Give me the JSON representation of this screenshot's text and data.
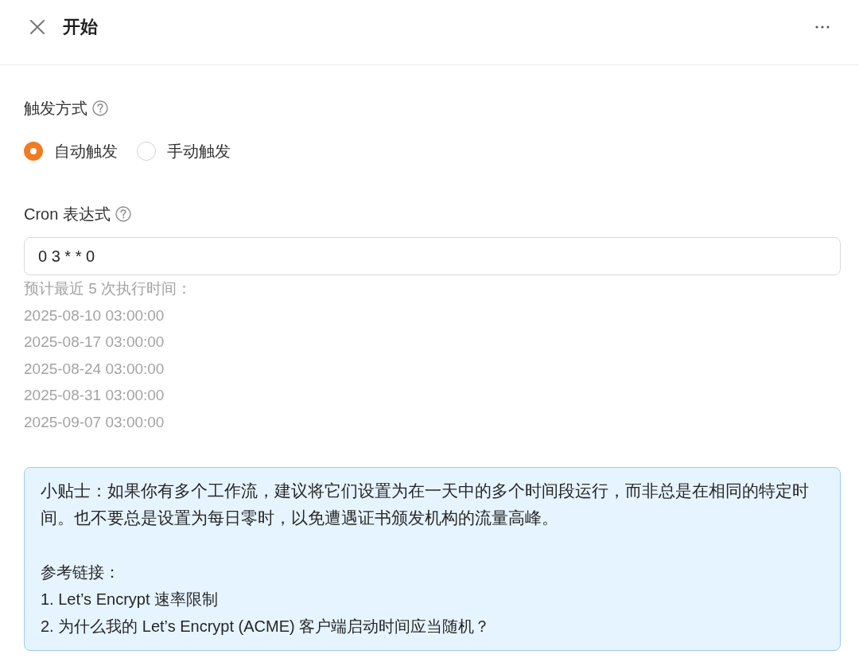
{
  "header": {
    "title": "开始"
  },
  "trigger": {
    "label": "触发方式",
    "options": [
      {
        "label": "自动触发",
        "selected": true
      },
      {
        "label": "手动触发",
        "selected": false
      }
    ]
  },
  "cron": {
    "label": "Cron 表达式",
    "value": "0 3 * * 0",
    "hint": "预计最近 5 次执行时间：",
    "next_runs": [
      "2025-08-10 03:00:00",
      "2025-08-17 03:00:00",
      "2025-08-24 03:00:00",
      "2025-08-31 03:00:00",
      "2025-09-07 03:00:00"
    ]
  },
  "tip": {
    "text": "小贴士：如果你有多个工作流，建议将它们设置为在一天中的多个时间段运行，而非总是在相同的特定时间。也不要总是设置为每日零时，以免遭遇证书颁发机构的流量高峰。",
    "references_heading": "参考链接：",
    "references": [
      "1. Let’s Encrypt 速率限制",
      "2. 为什么我的 Let’s Encrypt (ACME) 客户端启动时间应当随机？"
    ]
  }
}
